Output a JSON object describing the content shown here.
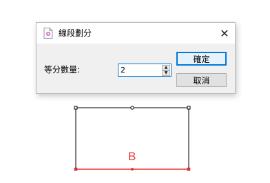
{
  "dialog": {
    "title": "線段劃分",
    "title_icon": "document-gear-icon",
    "close_glyph": "✕",
    "field_label": "等分數量:",
    "count_value": "2",
    "ok_label": "確定",
    "cancel_label": "取消"
  },
  "canvas": {
    "segment_label": "B",
    "segment_color": "#e8312f",
    "rect_color": "#000000"
  }
}
